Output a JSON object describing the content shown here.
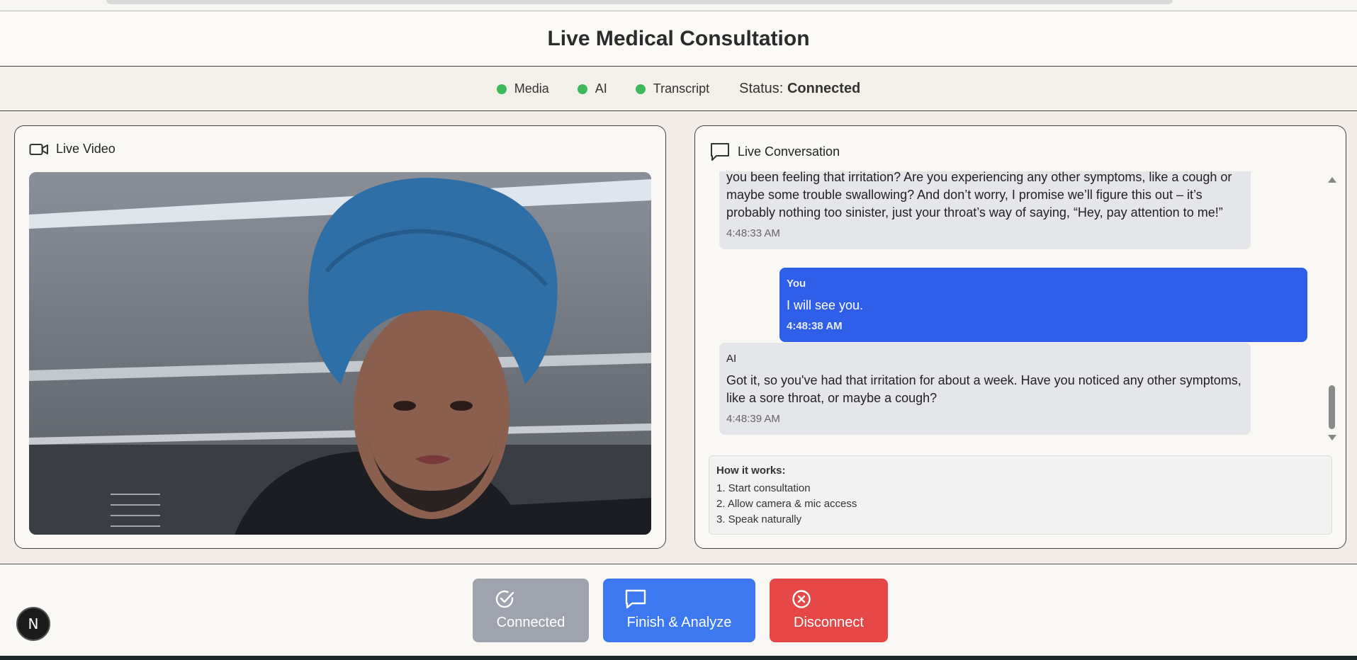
{
  "header": {
    "title": "Live Medical Consultation"
  },
  "status": {
    "indicators": [
      {
        "label": "Media",
        "color": "#3cb95b"
      },
      {
        "label": "AI",
        "color": "#3cb95b"
      },
      {
        "label": "Transcript",
        "color": "#3cb95b"
      }
    ],
    "label": "Status:",
    "value": "Connected"
  },
  "video_panel": {
    "title": "Live Video"
  },
  "chat_panel": {
    "title": "Live Conversation",
    "messages": [
      {
        "sender": "",
        "text": "you been feeling that irritation? Are you experiencing any other symptoms, like a cough or maybe some trouble swallowing? And don’t worry, I promise we’ll figure this out – it’s probably nothing too sinister, just your throat’s way of saying, “Hey, pay attention to me!”",
        "time": "4:48:33 AM"
      },
      {
        "sender": "You",
        "text": "I will see you.",
        "time": "4:48:38 AM"
      },
      {
        "sender": "AI",
        "text": "Got it, so you've had that irritation for about a week. Have you noticed any other symptoms, like a sore throat, or maybe a cough?",
        "time": "4:48:39 AM"
      }
    ]
  },
  "how_it_works": {
    "title": "How it works:",
    "steps": [
      "1. Start consultation",
      "2. Allow camera & mic access",
      "3. Speak naturally"
    ]
  },
  "buttons": {
    "connected": "Connected",
    "finish": "Finish & Analyze",
    "disconnect": "Disconnect"
  },
  "logo": {
    "letter": "N"
  },
  "colors": {
    "accent_blue": "#2f5fe8",
    "danger": "#e54646",
    "success": "#3cb95b",
    "disabled": "#9ea3ad"
  }
}
